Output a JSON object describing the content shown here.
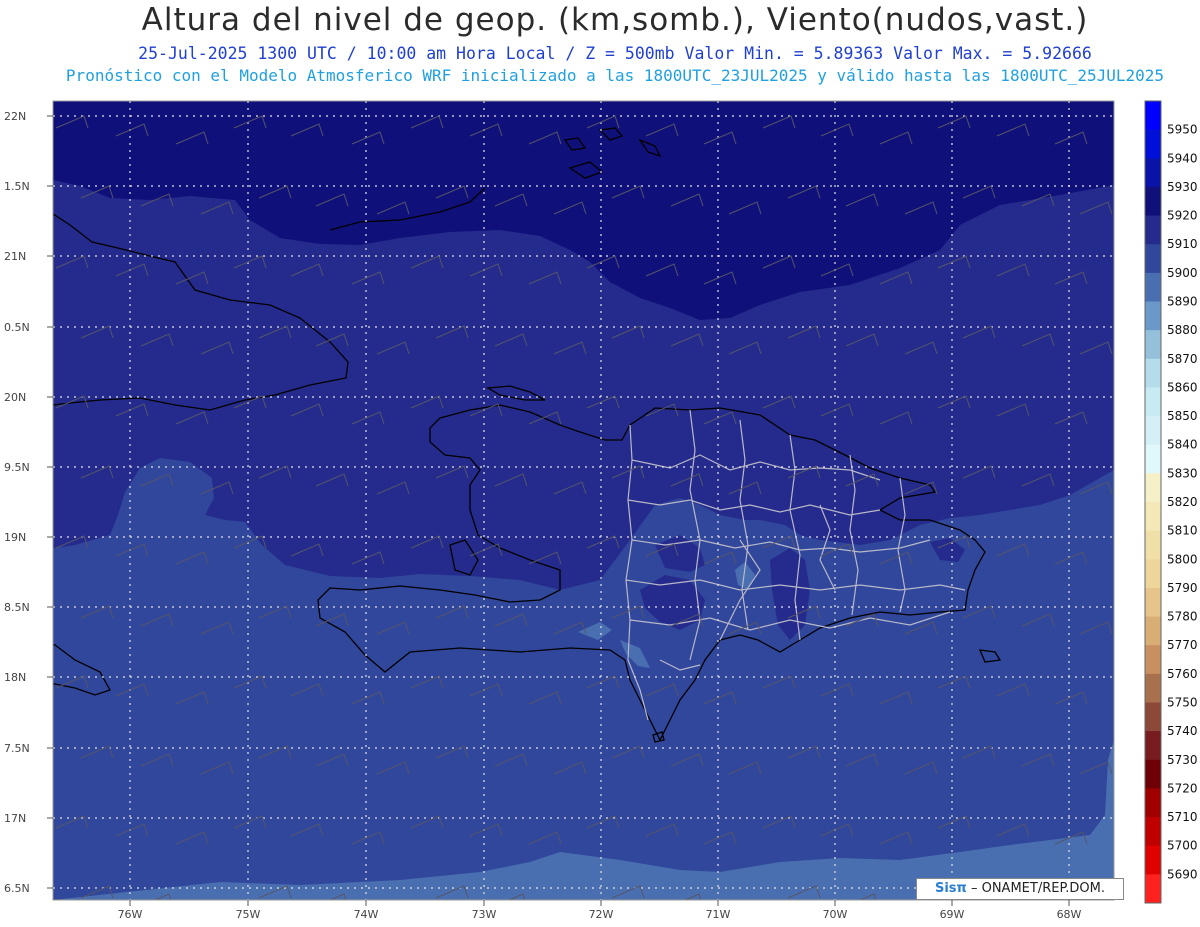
{
  "titles": {
    "main": "Altura del nivel de geop. (km,somb.), Viento(nudos,vast.)",
    "line2": "25-Jul-2025  1300 UTC / 10:00 am Hora Local / Z = 500mb   Valor Min. = 5.89363  Valor Max. = 5.92666",
    "line3": "Pronóstico con el Modelo Atmosferico WRF inicializado a las 1800UTC_23JUL2025 y válido hasta las  1800UTC_25JUL2025"
  },
  "lat_labels": [
    "22N",
    "1.5N",
    "21N",
    "0.5N",
    "20N",
    "9.5N",
    "19N",
    "8.5N",
    "18N",
    "7.5N",
    "17N",
    "6.5N"
  ],
  "lon_labels": [
    "76W",
    "75W",
    "74W",
    "73W",
    "72W",
    "71W",
    "70W",
    "69W",
    "68W"
  ],
  "colorbar": {
    "levels": [
      "5950",
      "5940",
      "5930",
      "5920",
      "5910",
      "5900",
      "5890",
      "5880",
      "5870",
      "5860",
      "5850",
      "5840",
      "5830",
      "5820",
      "5810",
      "5800",
      "5790",
      "5780",
      "5770",
      "5760",
      "5750",
      "5740",
      "5730",
      "5720",
      "5710",
      "5700",
      "5690"
    ],
    "colors": [
      "#0000ff",
      "#0010d8",
      "#0a13a8",
      "#10107a",
      "#252b8c",
      "#30479c",
      "#4a6fb0",
      "#6a98c8",
      "#94c0dc",
      "#b4dcea",
      "#c8eaf2",
      "#d4f0f6",
      "#e0f8fa",
      "#f6f0c8",
      "#f4e8b8",
      "#f0e0a8",
      "#eed69a",
      "#e6c48a",
      "#d8ae74",
      "#c89060",
      "#a8704c",
      "#8c4838",
      "#781c20",
      "#700008",
      "#a00000",
      "#c00000",
      "#e00000",
      "#ff2020"
    ]
  },
  "map_colors": {
    "level_5920": "#10107a",
    "level_5910": "#252b8c",
    "level_5900": "#30479c",
    "level_5890": "#4a6fb0",
    "coast": "#000000",
    "provinces": "#b0b0c0",
    "grid": "#e0e0e0"
  },
  "credit": {
    "logo": "Sisπ",
    "text": "– ONAMET/REP.DOM."
  }
}
